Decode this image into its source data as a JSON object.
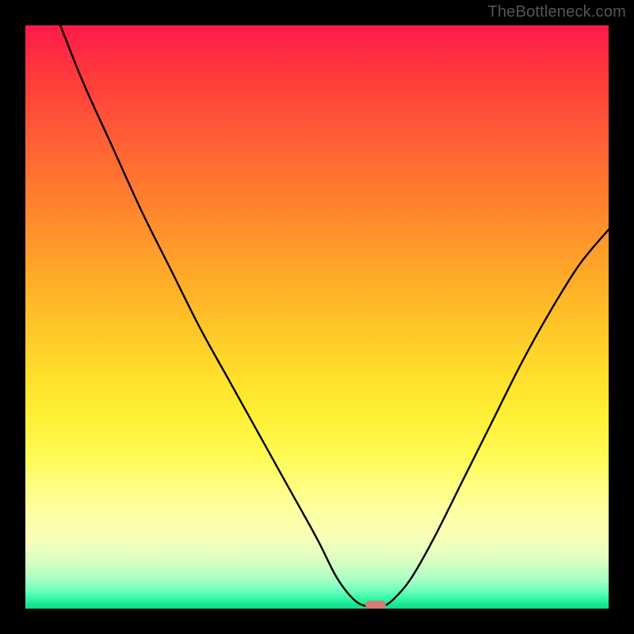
{
  "watermark": "TheBottleneck.com",
  "chart_data": {
    "type": "line",
    "title": "",
    "xlabel": "",
    "ylabel": "",
    "xlim": [
      0,
      100
    ],
    "ylim": [
      0,
      100
    ],
    "background_gradient": {
      "top": "#ff1a4a",
      "mid_upper": "#ff9a2a",
      "mid": "#ffee33",
      "mid_lower": "#f8ffb8",
      "bottom": "#14d987"
    },
    "curve_color": "#000000",
    "curve_points": [
      {
        "x": 6,
        "y": 100
      },
      {
        "x": 10,
        "y": 90
      },
      {
        "x": 15,
        "y": 79
      },
      {
        "x": 20,
        "y": 68
      },
      {
        "x": 25,
        "y": 58
      },
      {
        "x": 30,
        "y": 48
      },
      {
        "x": 35,
        "y": 39
      },
      {
        "x": 40,
        "y": 30
      },
      {
        "x": 45,
        "y": 21
      },
      {
        "x": 50,
        "y": 12
      },
      {
        "x": 53,
        "y": 6
      },
      {
        "x": 55,
        "y": 3
      },
      {
        "x": 57,
        "y": 1
      },
      {
        "x": 59,
        "y": 0.3
      },
      {
        "x": 61,
        "y": 0.3
      },
      {
        "x": 63,
        "y": 1.5
      },
      {
        "x": 66,
        "y": 5
      },
      {
        "x": 70,
        "y": 12
      },
      {
        "x": 75,
        "y": 22
      },
      {
        "x": 80,
        "y": 32
      },
      {
        "x": 85,
        "y": 42
      },
      {
        "x": 90,
        "y": 51
      },
      {
        "x": 95,
        "y": 59
      },
      {
        "x": 100,
        "y": 65
      }
    ],
    "minimum_marker": {
      "x": 60,
      "y": 0,
      "color": "#d67a72"
    }
  }
}
